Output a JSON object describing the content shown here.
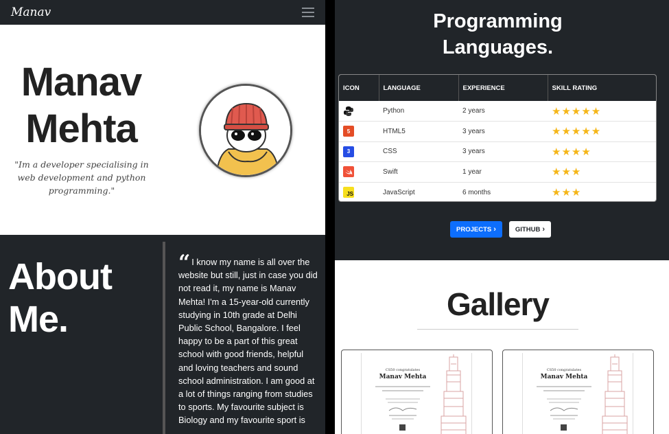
{
  "navbar": {
    "brand": "Manav"
  },
  "hero": {
    "name_line1": "Manav",
    "name_line2": "Mehta",
    "quote": "\"Im a developer specialising in web development and python programming.\""
  },
  "about": {
    "title_line1": "About",
    "title_line2": "Me.",
    "text": "I know my name is all over the website but still, just in case you did not read it, my name is Manav Mehta! I'm a 15-year-old currently studying in 10th grade at Delhi Public School, Bangalore. I feel happy to be a part of this great school with good friends, helpful and loving teachers and sound school administration. I am good at a lot of things ranging from studies to sports. My favourite subject is Biology and my favourite sport is"
  },
  "languages": {
    "title_line1": "Programming",
    "title_line2": "Languages.",
    "headers": {
      "icon": "ICON",
      "language": "LANGUAGE",
      "experience": "EXPERIENCE",
      "rating": "SKILL RATING"
    },
    "rows": [
      {
        "icon": "python-icon",
        "icon_text": "",
        "language": "Python",
        "experience": "2 years",
        "stars": 5
      },
      {
        "icon": "html5-icon",
        "icon_text": "5",
        "language": "HTML5",
        "experience": "3 years",
        "stars": 5
      },
      {
        "icon": "css-icon",
        "icon_text": "3",
        "language": "CSS",
        "experience": "3 years",
        "stars": 4
      },
      {
        "icon": "swift-icon",
        "icon_text": "",
        "language": "Swift",
        "experience": "1 year",
        "stars": 3
      },
      {
        "icon": "javascript-icon",
        "icon_text": "JS",
        "language": "JavaScript",
        "experience": "6 months",
        "stars": 3
      }
    ]
  },
  "buttons": {
    "projects": "PROJECTS",
    "github": "GITHUB"
  },
  "gallery": {
    "title": "Gallery",
    "cards": [
      {
        "header": "CS50 congratulates",
        "name": "Manav Mehta"
      },
      {
        "header": "CS50 congratulates",
        "name": "Manav Mehta"
      }
    ]
  },
  "colors": {
    "dark": "#212529",
    "primary": "#0d6efd",
    "star": "#f5b618",
    "html5": "#e44d26",
    "css": "#264de4",
    "swift": "#f05138",
    "javascript": "#f7df1e"
  }
}
